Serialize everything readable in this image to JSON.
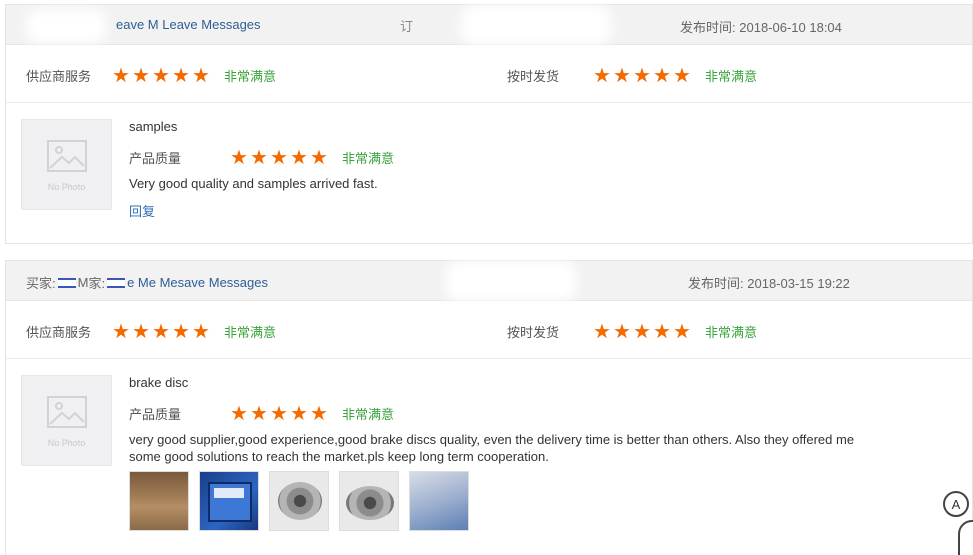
{
  "reviews": [
    {
      "buyer_name": "eave M Leave Messages",
      "mark": "订",
      "time_label": "发布时间:",
      "time_value": "2018-06-10 18:04",
      "supplier_service_label": "供应商服务",
      "supplier_service_rating": 5,
      "supplier_service_text": "非常满意",
      "on_time_label": "按时发货",
      "on_time_rating": 5,
      "on_time_text": "非常满意",
      "photo_text": "No Photo",
      "product": "samples",
      "quality_label": "产品质量",
      "quality_rating": 5,
      "quality_text": "非常满意",
      "comment": "Very good quality and samples arrived fast.",
      "reply_label": "回复"
    },
    {
      "buyer_prefix": "买家:",
      "buyer_prefix2": "M",
      "buyer_mid": "家:",
      "buyer_name": "e Me Mesave Messages",
      "time_label": "发布时间:",
      "time_value": "2018-03-15 19:22",
      "supplier_service_label": "供应商服务",
      "supplier_service_rating": 5,
      "supplier_service_text": "非常满意",
      "on_time_label": "按时发货",
      "on_time_rating": 5,
      "on_time_text": "非常满意",
      "photo_text": "No Photo",
      "product": "brake disc",
      "quality_label": "产品质量",
      "quality_rating": 5,
      "quality_text": "非常满意",
      "comment": "very good supplier,good experience,good brake discs quality, even the delivery time is better than others. Also they offered me some good solutions to reach the market.pls keep long term cooperation."
    }
  ],
  "float_button": "A",
  "colors": {
    "star": "#f56a00",
    "satisfied": "#3aa33c",
    "link": "#2f6db3",
    "header_bg": "#f2f2f2"
  }
}
